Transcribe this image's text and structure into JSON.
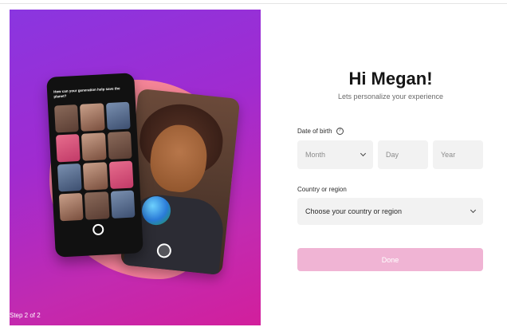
{
  "hero": {
    "step_label": "Step 2 of 2",
    "phone_question": "How can your generation help save the planet?"
  },
  "form": {
    "title": "Hi Megan!",
    "subtitle": "Lets personalize your experience",
    "dob_label": "Date of birth",
    "month_value": "Month",
    "day_value": "Day",
    "year_value": "Year",
    "country_label": "Country or region",
    "country_value": "Choose your country or region",
    "done_label": "Done"
  },
  "icons": {
    "info": "info-icon",
    "chevron": "chevron-down-icon"
  },
  "colors": {
    "hero_gradient_start": "#8a36e0",
    "hero_gradient_end": "#d21f9c",
    "done_disabled": "#f0b4d4",
    "field_bg": "#f2f2f2"
  }
}
